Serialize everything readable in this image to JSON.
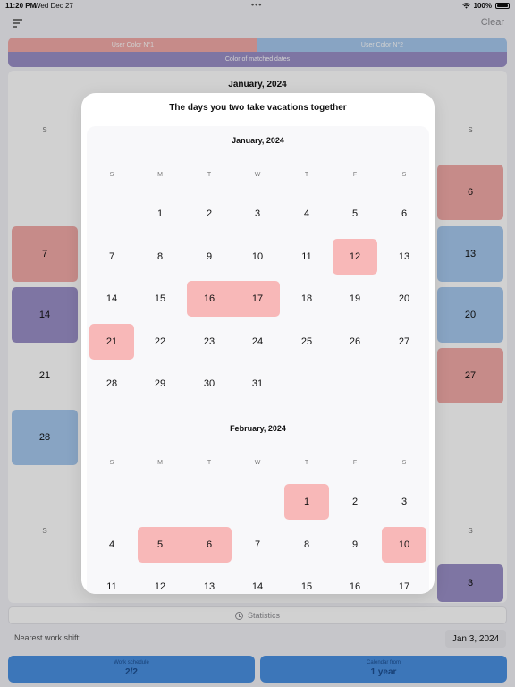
{
  "status_bar": {
    "time": "11:20 PM",
    "date": "Wed Dec 27",
    "battery": "100%"
  },
  "header": {
    "clear_label": "Clear"
  },
  "legend": {
    "user1": "User Color N°1",
    "user2": "User Color N°2",
    "matched": "Color of matched dates"
  },
  "colors": {
    "user1": "#f2aaa8",
    "user2": "#a6c8ee",
    "matched": "#9a8fc7",
    "highlight": "#f8b8b8",
    "primary_button": "#4a90e2"
  },
  "background_calendar": {
    "month": "January, 2024",
    "weekday_left": "S",
    "weekday_right": "S",
    "left_cells": [
      "7",
      "14",
      "21",
      "28"
    ],
    "right_cells": [
      "6",
      "13",
      "20",
      "27"
    ],
    "feb_weekday_left": "S",
    "feb_weekday_right": "S",
    "feb_right_cell": "3"
  },
  "modal": {
    "title": "The days you two take vacations together",
    "weekdays": [
      "S",
      "M",
      "T",
      "W",
      "T",
      "F",
      "S"
    ],
    "months": [
      {
        "name": "January, 2024",
        "weeks": [
          [
            "",
            "1",
            "2",
            "3",
            "4",
            "5",
            "6"
          ],
          [
            "7",
            "8",
            "9",
            "10",
            "11",
            "12",
            "13"
          ],
          [
            "14",
            "15",
            "16",
            "17",
            "18",
            "19",
            "20"
          ],
          [
            "21",
            "22",
            "23",
            "24",
            "25",
            "26",
            "27"
          ],
          [
            "28",
            "29",
            "30",
            "31",
            "",
            "",
            ""
          ]
        ],
        "highlighted": [
          "12",
          "16",
          "17",
          "21"
        ]
      },
      {
        "name": "February, 2024",
        "weeks": [
          [
            "",
            "",
            "",
            "",
            "1",
            "2",
            "3"
          ],
          [
            "4",
            "5",
            "6",
            "7",
            "8",
            "9",
            "10"
          ],
          [
            "11",
            "12",
            "13",
            "14",
            "15",
            "16",
            "17"
          ]
        ],
        "highlighted": [
          "1",
          "5",
          "6",
          "10"
        ]
      }
    ]
  },
  "statistics": {
    "label": "Statistics"
  },
  "nearest_shift": {
    "label": "Nearest work shift:",
    "value": "Jan 3, 2024"
  },
  "buttons": [
    {
      "caption": "Work schedule",
      "value": "2/2"
    },
    {
      "caption": "Calendar from",
      "value": "1 year"
    }
  ]
}
